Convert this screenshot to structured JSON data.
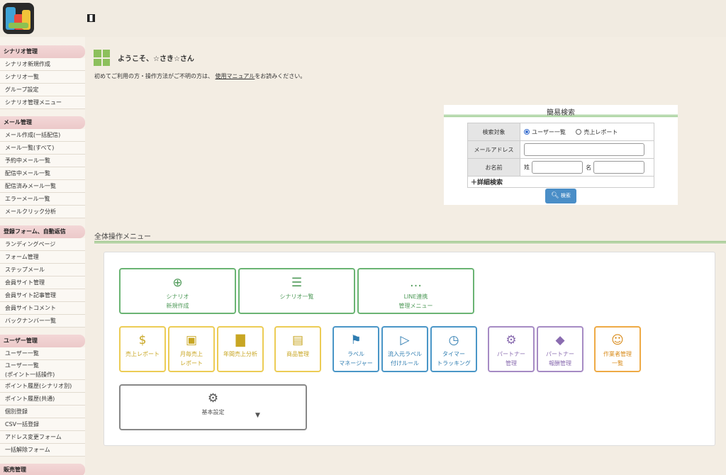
{
  "sidebar": {
    "sections": [
      {
        "title": "シナリオ管理",
        "items": [
          "シナリオ新規作成",
          "シナリオ一覧",
          "グループ設定",
          "シナリオ管理メニュー"
        ]
      },
      {
        "title": "メール管理",
        "items": [
          "メール作成(一括配信)",
          "メール一覧(すべて)",
          "予約中メール一覧",
          "配信中メール一覧",
          "配信済みメール一覧",
          "エラーメール一覧",
          "メールクリック分析"
        ]
      },
      {
        "title": "登録フォーム、自動返信",
        "items": [
          "ランディングページ",
          "フォーム管理",
          "ステップメール",
          "会員サイト管理",
          "会員サイト記事管理",
          "会員サイトコメント",
          "バックナンバー一覧"
        ]
      },
      {
        "title": "ユーザー管理",
        "items": [
          "ユーザー一覧",
          "ユーザー一覧\n(ポイント一括操作)",
          "ポイント履歴(シナリオ別)",
          "ポイント履歴(共通)",
          "個別登録",
          "CSV一括登録",
          "アドレス変更フォーム",
          "一括解除フォーム"
        ]
      },
      {
        "title": "販売管理",
        "items": []
      }
    ]
  },
  "main": {
    "welcome": "ようこそ、☆さき☆さん",
    "intro_before": "初めてご利用の方・操作方法がご不明の方は、",
    "intro_link": "使用マニュアル",
    "intro_after": "をお読みください。"
  },
  "search": {
    "title": "簡易検索",
    "target_label": "検索対象",
    "option_users": "ユーザー一覧",
    "option_sales": "売上レポート",
    "email_label": "メールアドレス",
    "name_label": "お名前",
    "last_name": "姓",
    "first_name": "名",
    "advanced": "＋詳細検索",
    "button": "検索"
  },
  "ops": {
    "title": "全体操作メニュー",
    "tiles": {
      "scenario_new": [
        "シナリオ",
        "新規作成"
      ],
      "scenario_list": [
        "シナリオ一覧"
      ],
      "line": [
        "LINE連携",
        "管理メニュー"
      ],
      "sales_report": [
        "売上レポート"
      ],
      "monthly": [
        "月毎売上",
        "レポート"
      ],
      "annual": [
        "年間売上分析"
      ],
      "products": [
        "商品管理"
      ],
      "label_mgr": [
        "ラベル",
        "マネージャー"
      ],
      "source_label": [
        "流入元ラベル",
        "付けルール"
      ],
      "timer": [
        "タイマー",
        "トラッキング"
      ],
      "partner": [
        "パートナー",
        "管理"
      ],
      "partner_reward": [
        "パートナー",
        "報酬管理"
      ],
      "worker": [
        "作業者管理",
        "一覧"
      ],
      "basic": [
        "基本設定"
      ]
    }
  },
  "colors": {
    "green": "#6ab473",
    "yellow": "#eccc55",
    "blue": "#4a96c7",
    "purple": "#a68bc4",
    "orange": "#eeaa45",
    "gray": "#888888"
  }
}
